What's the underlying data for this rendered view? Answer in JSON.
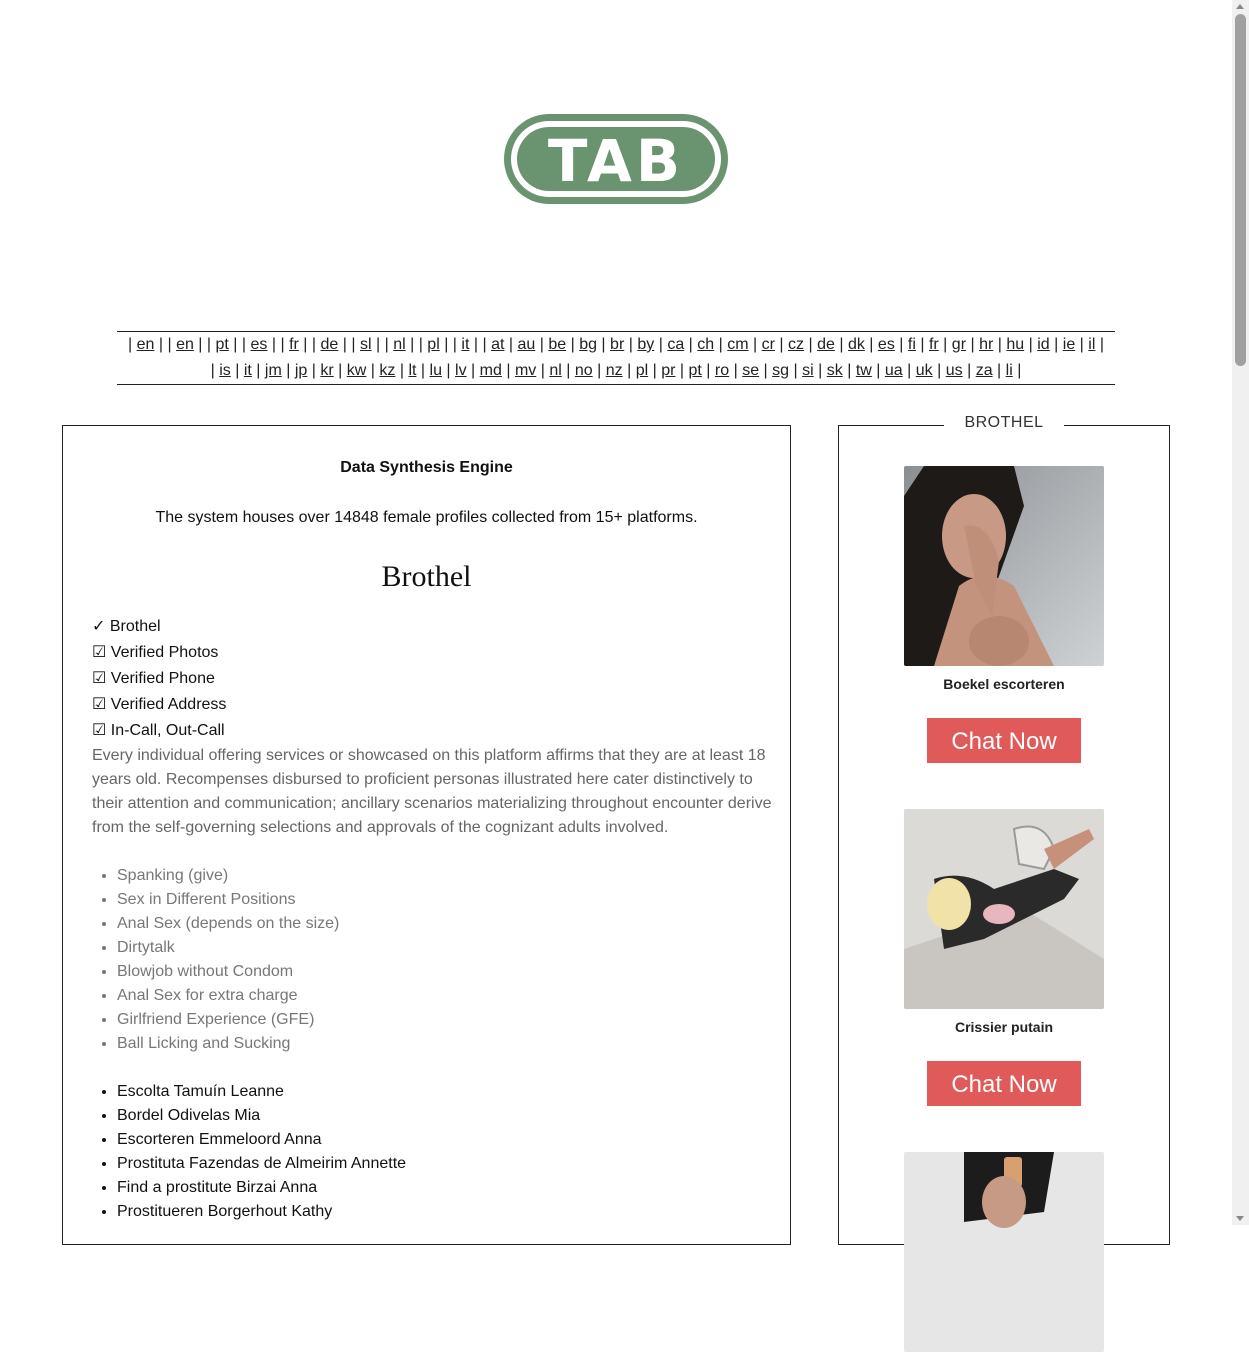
{
  "logo": {
    "text": "TAB",
    "color": "#6a9470"
  },
  "nav_langs_row1": [
    "en",
    "en",
    "pt",
    "es",
    "fr",
    "de",
    "sl",
    "nl",
    "pl",
    "it",
    "at",
    "au",
    "be",
    "bg",
    "br",
    "by",
    "ca",
    "ch",
    "cm",
    "cr",
    "cz",
    "de",
    "dk",
    "es",
    "fi",
    "fr",
    "gr",
    "hr",
    "hu",
    "id",
    "ie",
    "il"
  ],
  "nav_langs_row2": [
    "is",
    "it",
    "jm",
    "jp",
    "kr",
    "kw",
    "kz",
    "lt",
    "lu",
    "lv",
    "md",
    "mv",
    "nl",
    "no",
    "nz",
    "pl",
    "pr",
    "pt",
    "ro",
    "se",
    "sg",
    "si",
    "sk",
    "tw",
    "ua",
    "uk",
    "us",
    "za",
    "li"
  ],
  "main": {
    "engine_title": "Data Synthesis Engine",
    "engine_desc": "The system houses over 14848 female profiles collected from 15+ platforms.",
    "heading": "Brothel",
    "checklist": [
      "✓ Brothel",
      "☑ Verified Photos",
      "☑ Verified Phone",
      "☑ Verified Address",
      "☑ In-Call, Out-Call"
    ],
    "disclaimer": "Every individual offering services or showcased on this platform affirms that they are at least 18 years old. Recompenses disbursed to proficient personas illustrated here cater distinctively to their attention and communication; ancillary scenarios materializing throughout encounter derive from the self-governing selections and approvals of the cognizant adults involved.",
    "services": [
      "Spanking (give)",
      "Sex in Different Positions",
      "Anal Sex (depends on the size)",
      "Dirtytalk",
      "Blowjob without Condom",
      "Anal Sex for extra charge",
      "Girlfriend Experience (GFE)",
      "Ball Licking and Sucking"
    ],
    "links": [
      "Escolta Tamuín Leanne",
      "Bordel Odivelas Mia",
      "Escorteren Emmeloord Anna",
      "Prostituta Fazendas de Almeirim Annette",
      "Find a prostitute Birzai Anna",
      "Prostitueren Borgerhout Kathy"
    ]
  },
  "sidebar": {
    "legend": "BROTHEL",
    "cards": [
      {
        "name": "Boekel escorteren",
        "button": "Chat Now"
      },
      {
        "name": "Crissier putain",
        "button": "Chat Now"
      },
      {
        "name": "",
        "button": ""
      }
    ]
  },
  "colors": {
    "button": "#e05a5a",
    "logo": "#6a9470"
  }
}
